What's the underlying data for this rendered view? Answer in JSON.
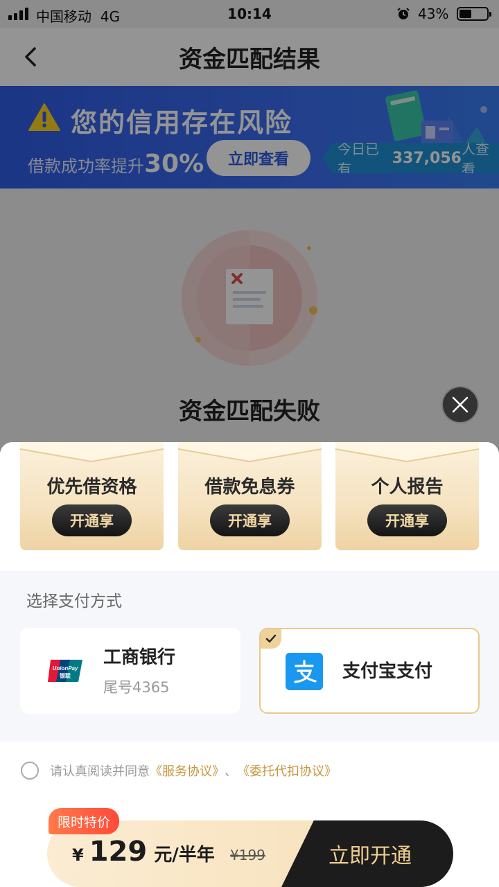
{
  "status_bar": {
    "carrier": "中国移动",
    "network": "4G",
    "time": "10:14",
    "battery": "43%",
    "battery_level": 0.43
  },
  "nav": {
    "title": "资金匹配结果",
    "back_icon": "chevron-left-icon"
  },
  "banner": {
    "headline": "您的信用存在风险",
    "sub_prefix": "借款成功率提升",
    "sub_value": "30%",
    "button": "立即查看",
    "viewers_prefix": "今日已有",
    "viewers_count": "337,056",
    "viewers_suffix": "人查看",
    "colors": {
      "background": "#3b6cf0",
      "pill": "#1f8fd6"
    }
  },
  "result": {
    "title": "资金匹配失败"
  },
  "sheet": {
    "benefits": [
      {
        "name": "优先借资格",
        "button": "开通享"
      },
      {
        "name": "借款免息券",
        "button": "开通享"
      },
      {
        "name": "个人报告",
        "button": "开通享"
      }
    ],
    "payment": {
      "label": "选择支付方式",
      "options": [
        {
          "name": "工商银行",
          "tail": "尾号4365",
          "icon": "unionpay-icon",
          "selected": false
        },
        {
          "name": "支付宝支付",
          "icon": "alipay-icon",
          "selected": true
        }
      ]
    },
    "agreement": {
      "text": "请认真阅读并同意",
      "link1": "《服务协议》",
      "separator": "、",
      "link2": "《委托代扣协议》",
      "checked": false
    },
    "purchase": {
      "promo_tag": "限时特价",
      "currency": "¥",
      "price": "129",
      "unit": "元/半年",
      "original_price": "¥199",
      "button": "立即开通"
    }
  },
  "colors": {
    "gold": "#c7963f",
    "gold_light": "#efcd8e",
    "dark": "#1c1c1c",
    "alipay_blue": "#1a98f0",
    "promo_red": "#ff4a3a"
  }
}
